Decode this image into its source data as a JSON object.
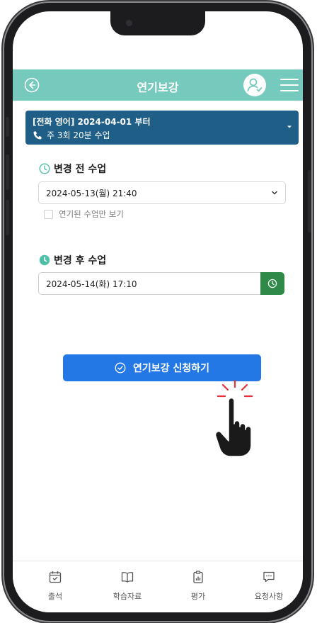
{
  "header": {
    "title": "연기보강"
  },
  "course": {
    "title": "[전화 영어] 2024-04-01 부터",
    "schedule": "주 3회 20분 수업"
  },
  "before": {
    "label": "변경 전 수업",
    "selected": "2024-05-13(월) 21:40",
    "checkbox_label": "연기된 수업만 보기"
  },
  "after": {
    "label": "변경 후 수업",
    "value": "2024-05-14(화) 17:10"
  },
  "submit": {
    "label": "연기보강 신청하기"
  },
  "nav": [
    {
      "label": "출석",
      "icon": "calendar-check-icon"
    },
    {
      "label": "학습자료",
      "icon": "book-icon"
    },
    {
      "label": "평가",
      "icon": "clipboard-chart-icon"
    },
    {
      "label": "요청사항",
      "icon": "chat-icon"
    }
  ],
  "colors": {
    "header": "#76c9bd",
    "course_bar": "#1f5f87",
    "submit": "#2478e6",
    "time_button": "#2f8a49"
  }
}
